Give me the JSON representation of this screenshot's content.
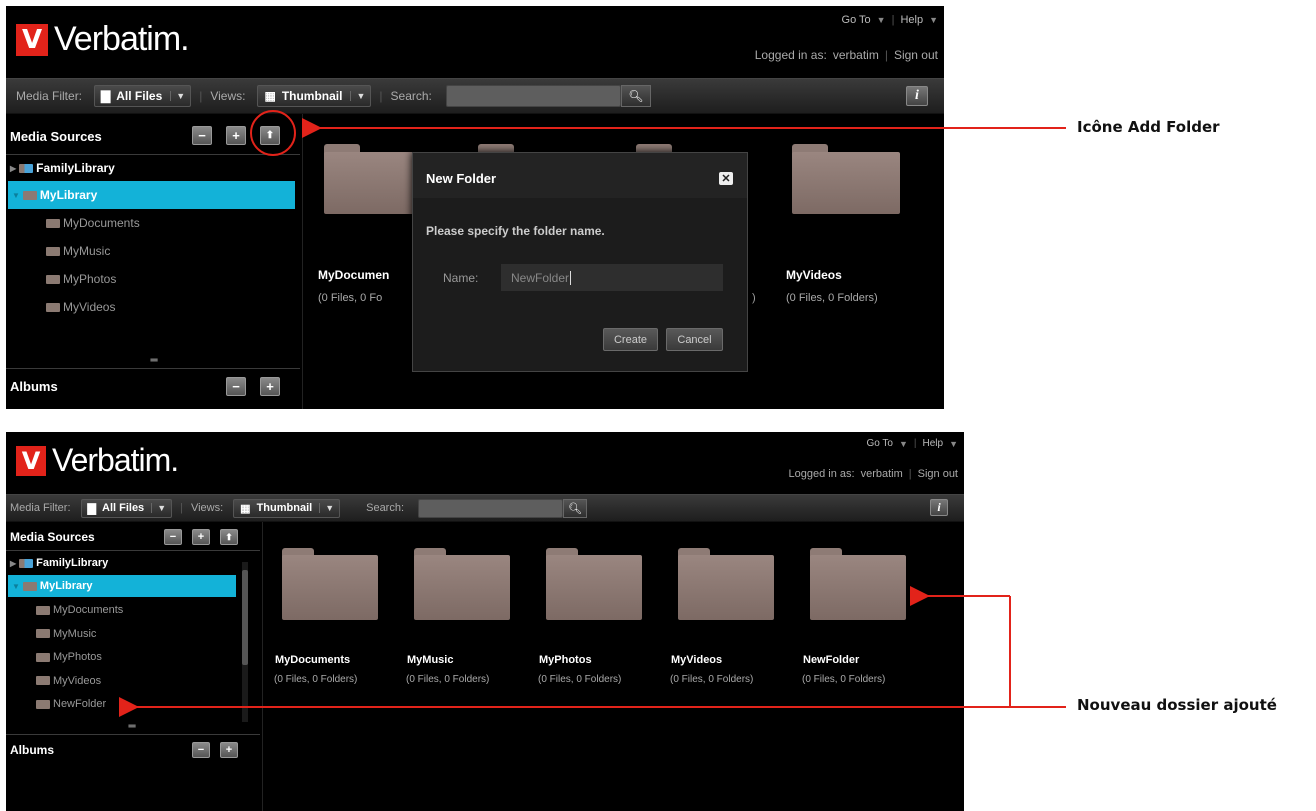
{
  "app": {
    "brand": "Verbatim.",
    "brand_mark": "V",
    "goto": "Go To",
    "help": "Help",
    "logged_in_label": "Logged in as:",
    "username": "verbatim",
    "sign_out": "Sign out"
  },
  "toolbar": {
    "media_filter_label": "Media Filter:",
    "media_filter_value": "All Files",
    "views_label": "Views:",
    "views_value": "Thumbnail",
    "search_label": "Search:",
    "search_value": "",
    "info_glyph": "i"
  },
  "sidebar": {
    "media_sources_title": "Media Sources",
    "albums_title": "Albums",
    "minus": "−",
    "plus": "+",
    "up": "⬆",
    "tree_top": [
      {
        "label": "FamilyLibrary"
      },
      {
        "label": "MyLibrary"
      }
    ],
    "children_before": [
      "MyDocuments",
      "MyMusic",
      "MyPhotos",
      "MyVideos"
    ],
    "children_after": [
      "MyDocuments",
      "MyMusic",
      "MyPhotos",
      "MyVideos",
      "NewFolder"
    ]
  },
  "folders_before": [
    {
      "name": "MyDocumen",
      "meta": "(0 Files, 0 Fo"
    },
    {
      "name": "",
      "meta": ")"
    },
    {
      "name": "",
      "meta": ""
    },
    {
      "name": "MyVideos",
      "meta": "(0 Files, 0 Folders)"
    }
  ],
  "folders_after": [
    {
      "name": "MyDocuments",
      "meta": "(0 Files, 0 Folders)"
    },
    {
      "name": "MyMusic",
      "meta": "(0 Files, 0 Folders)"
    },
    {
      "name": "MyPhotos",
      "meta": "(0 Files, 0 Folders)"
    },
    {
      "name": "MyVideos",
      "meta": "(0 Files, 0 Folders)"
    },
    {
      "name": "NewFolder",
      "meta": "(0 Files, 0 Folders)"
    }
  ],
  "dialog": {
    "title": "New Folder",
    "close": "✕",
    "message": "Please specify the folder name.",
    "name_label": "Name:",
    "name_value": "NewFolder",
    "create": "Create",
    "cancel": "Cancel"
  },
  "callouts": {
    "add_folder": "Icône Add Folder",
    "new_folder_added": "Nouveau dossier ajouté"
  },
  "colors": {
    "accent_selected": "#13b2d8",
    "callout_red": "#e2231a",
    "brand_red": "#e2231a",
    "folder": "#8e7b75"
  }
}
